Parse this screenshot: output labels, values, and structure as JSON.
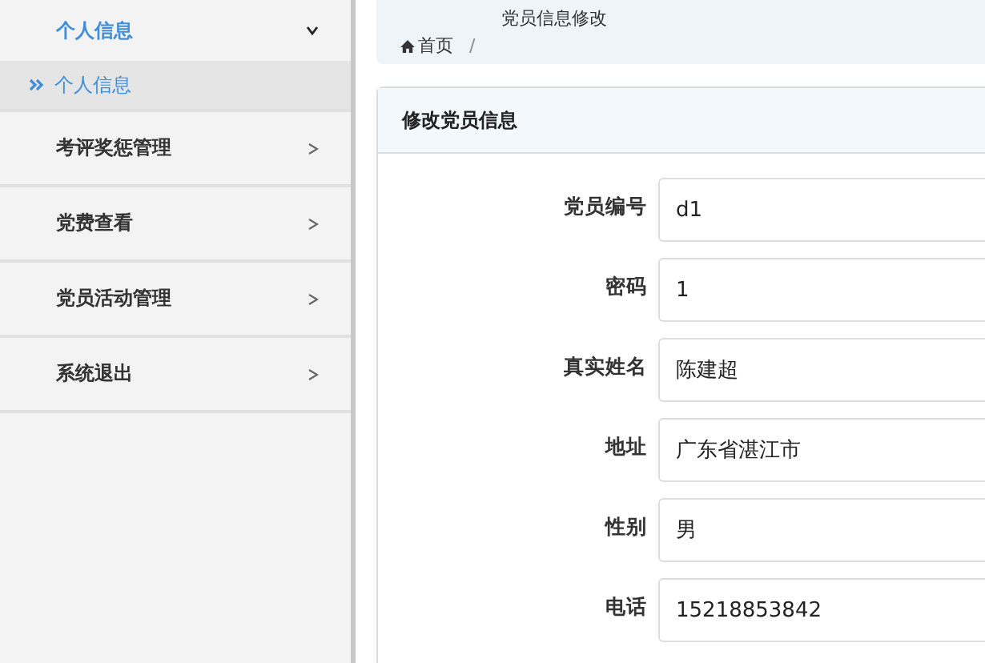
{
  "sidebar": {
    "menus": [
      {
        "label": "个人信息",
        "expanded": true,
        "children": [
          {
            "label": "个人信息",
            "selected": true
          }
        ]
      },
      {
        "label": "考评奖惩管理",
        "expanded": false
      },
      {
        "label": "党费查看",
        "expanded": false
      },
      {
        "label": "党员活动管理",
        "expanded": false
      },
      {
        "label": "系统退出",
        "expanded": false
      }
    ]
  },
  "breadcrumb": {
    "current": "党员信息修改",
    "home": "首页",
    "separator": "/"
  },
  "form": {
    "title": "修改党员信息",
    "fields": [
      {
        "label": "党员编号",
        "value": "d1"
      },
      {
        "label": "密码",
        "value": "1"
      },
      {
        "label": "真实姓名",
        "value": "陈建超"
      },
      {
        "label": "地址",
        "value": "广东省湛江市"
      },
      {
        "label": "性别",
        "value": "男"
      },
      {
        "label": "电话",
        "value": "15218853842"
      }
    ]
  }
}
